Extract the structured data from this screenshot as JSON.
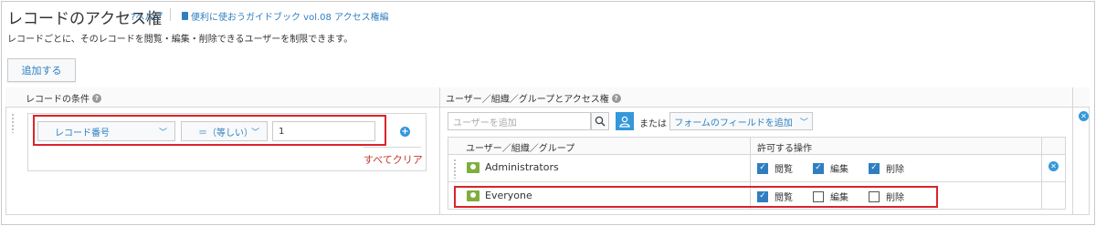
{
  "header": {
    "title": "レコードのアクセス権",
    "help_label": "?ヘルプ",
    "guide_label": "便利に使おうガイドブック vol.08 アクセス権編"
  },
  "description": "レコードごとに、そのレコードを閲覧・編集・削除できるユーザーを制限できます。",
  "add_button": "追加する",
  "table": {
    "condition_header": "レコードの条件",
    "user_header": "ユーザー／組織／グループとアクセス権"
  },
  "condition": {
    "field_select": "レコード番号",
    "operator_select": "＝（等しい）",
    "value": "1",
    "clear_all": "すべてクリア"
  },
  "user_panel": {
    "search_placeholder": "ユーザーを追加",
    "or_text": "または",
    "field_button": "フォームのフィールドを追加",
    "col_user": "ユーザー／組織／グループ",
    "col_perm": "許可する操作"
  },
  "permission_labels": {
    "view": "閲覧",
    "edit": "編集",
    "delete": "削除"
  },
  "entities": [
    {
      "name": "Administrators",
      "view": true,
      "edit": true,
      "delete": true
    },
    {
      "name": "Everyone",
      "view": true,
      "edit": false,
      "delete": false
    }
  ],
  "colors": {
    "accent": "#2f7fc0",
    "highlight": "#d9242b",
    "group_icon": "#7fae3f",
    "clear_link": "#c0392b"
  }
}
